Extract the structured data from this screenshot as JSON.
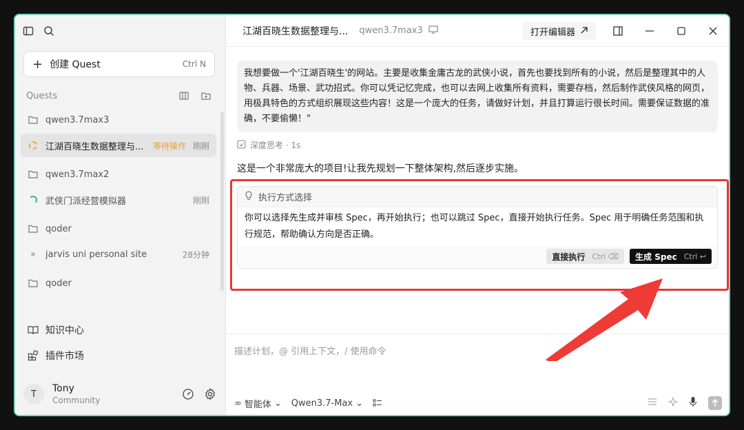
{
  "sidebar": {
    "create_label": "创建 Quest",
    "create_shortcut": "Ctrl N",
    "quests_heading": "Quests",
    "items": [
      {
        "label": "qwen3.7max3",
        "type": "folder"
      },
      {
        "label": "江湖百晓生数据整理与...",
        "badge": "等待操作",
        "time": "刚刚",
        "type": "active"
      },
      {
        "label": "qwen3.7max2",
        "type": "folder"
      },
      {
        "label": "武侠门派经营模拟器",
        "time": "刚刚",
        "type": "task"
      },
      {
        "label": "qoder",
        "type": "folder"
      },
      {
        "label": "jarvis uni personal site",
        "time": "28分钟",
        "type": "dot"
      },
      {
        "label": "qoder",
        "type": "folder"
      }
    ],
    "bottom": [
      {
        "label": "知识中心"
      },
      {
        "label": "插件市场"
      }
    ],
    "user": {
      "initial": "T",
      "name": "Tony",
      "plan": "Community"
    }
  },
  "header": {
    "title": "江湖百晓生数据整理与...",
    "model": "qwen3.7max3",
    "open_editor": "打开编辑器"
  },
  "chat": {
    "user_message": "我想要做一个'江湖百晓生'的网站。主要是收集金庸古龙的武侠小说，首先也要找到所有的小说，然后是整理其中的人物、兵器、场景、武功招式。你可以凭记忆完成，也可以去网上收集所有资料，需要存档，然后制作武侠风格的网页，用极具特色的方式组织展现这些内容！这是一个庞大的任务，请做好计划，并且打算运行很长时间。需要保证数据的准确，不要偷懒！\"",
    "thinking": "深度思考 · 1s",
    "response": "这是一个非常庞大的项目!让我先规划一下整体架构,然后逐步实施。",
    "card": {
      "title": "执行方式选择",
      "body": "你可以选择先生成并审核 Spec，再开始执行；也可以跳过 Spec，直接开始执行任务。Spec 用于明确任务范围和执行规范，帮助确认方向是否正确。",
      "direct_label": "直接执行",
      "direct_shortcut": "Ctrl ⌫",
      "spec_label": "生成 Spec",
      "spec_shortcut": "Ctrl ↩"
    }
  },
  "input": {
    "placeholder": "描述计划，@ 引用上下文，/ 使用命令",
    "agent_label": "智能体",
    "model_label": "Qwen3.7-Max"
  },
  "colors": {
    "highlight": "#e53935",
    "pending": "#e5a13a",
    "window_border": "#7fd3c7"
  }
}
